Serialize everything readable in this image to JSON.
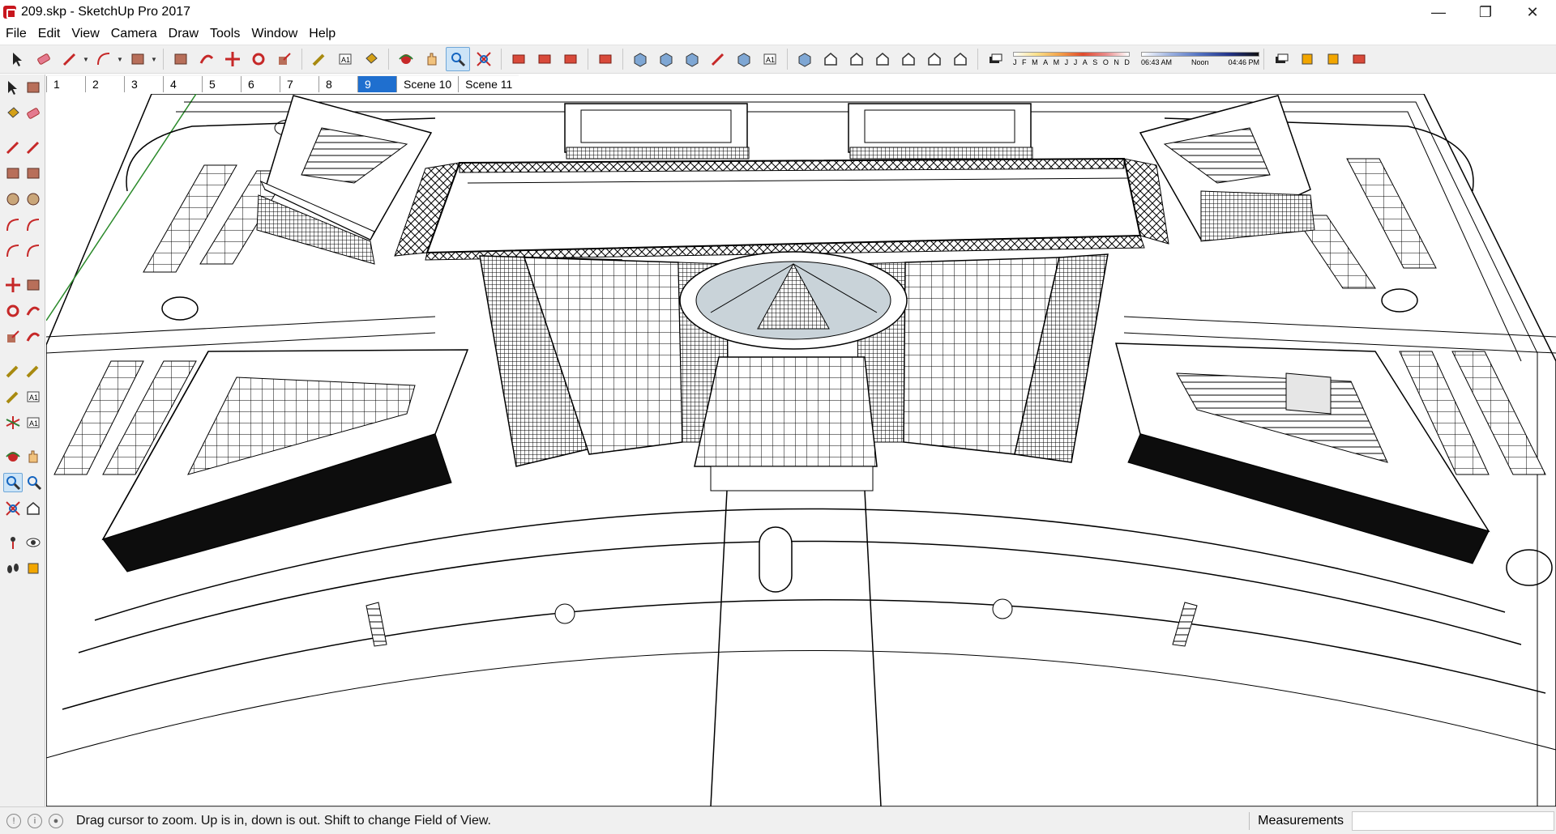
{
  "window": {
    "title": "209.skp - SketchUp Pro 2017",
    "controls": {
      "minimize": "—",
      "restore": "❐",
      "close": "✕"
    }
  },
  "menu": [
    "File",
    "Edit",
    "View",
    "Camera",
    "Draw",
    "Tools",
    "Window",
    "Help"
  ],
  "toolbar": {
    "icons": [
      "select-icon",
      "eraser-icon",
      "pencil-icon",
      "arc-icon",
      "rectangle-icon",
      "push-pull-icon",
      "follow-me-icon",
      "move-icon",
      "rotate-icon",
      "scale-icon",
      "tape-measure-icon",
      "text-icon",
      "paint-bucket-icon",
      "orbit-icon",
      "pan-icon",
      "zoom-icon",
      "zoom-extents-icon",
      "warehouse-icon",
      "extension-warehouse-icon",
      "layout-icon",
      "ruby-icon",
      "xray-icon",
      "back-edges-icon",
      "wireframe-icon",
      "hidden-line-icon",
      "shaded-icon",
      "shaded-textures-icon",
      "monochrome-icon",
      "iso-view-icon",
      "top-view-icon",
      "front-view-icon",
      "right-view-icon",
      "back-view-icon",
      "left-view-icon",
      "shadows-toggle-icon",
      "section-fill-icon",
      "section-plane-icon",
      "download-icon"
    ],
    "active": "zoom-icon",
    "shadow_months": [
      "J",
      "F",
      "M",
      "A",
      "M",
      "J",
      "J",
      "A",
      "S",
      "O",
      "N",
      "D"
    ],
    "shadow_time": {
      "start": "06:43 AM",
      "mid": "Noon",
      "end": "04:46 PM"
    }
  },
  "left_tools": [
    [
      "select-icon",
      "make-component-icon"
    ],
    [
      "paint-bucket-icon",
      "eraser-icon"
    ],
    [
      "line-icon",
      "freehand-icon"
    ],
    [
      "rectangle-icon",
      "rotated-rectangle-icon"
    ],
    [
      "circle-icon",
      "polygon-icon"
    ],
    [
      "arc-icon",
      "two-point-arc-icon"
    ],
    [
      "three-point-arc-icon",
      "pie-icon"
    ],
    [
      "move-icon",
      "push-pull-icon"
    ],
    [
      "rotate-icon",
      "follow-me-icon"
    ],
    [
      "scale-icon",
      "offset-icon"
    ],
    [
      "tape-measure-icon",
      "dimension-icon"
    ],
    [
      "protractor-icon",
      "text-icon"
    ],
    [
      "axes-icon",
      "3d-text-icon"
    ],
    [
      "orbit-icon",
      "pan-icon"
    ],
    [
      "zoom-icon",
      "zoom-window-icon"
    ],
    [
      "zoom-extents-icon",
      "previous-view-icon"
    ],
    [
      "position-camera-icon",
      "look-around-icon"
    ],
    [
      "walk-icon",
      "section-plane-icon"
    ]
  ],
  "scene_tabs": [
    "1",
    "2",
    "3",
    "4",
    "5",
    "6",
    "7",
    "8",
    "9",
    "Scene 10",
    "Scene 11"
  ],
  "active_scene": "9",
  "status": {
    "message": "Drag cursor to zoom.  Up is in, down is out. Shift to change Field of View.",
    "measurements_label": "Measurements",
    "measurements_value": ""
  }
}
